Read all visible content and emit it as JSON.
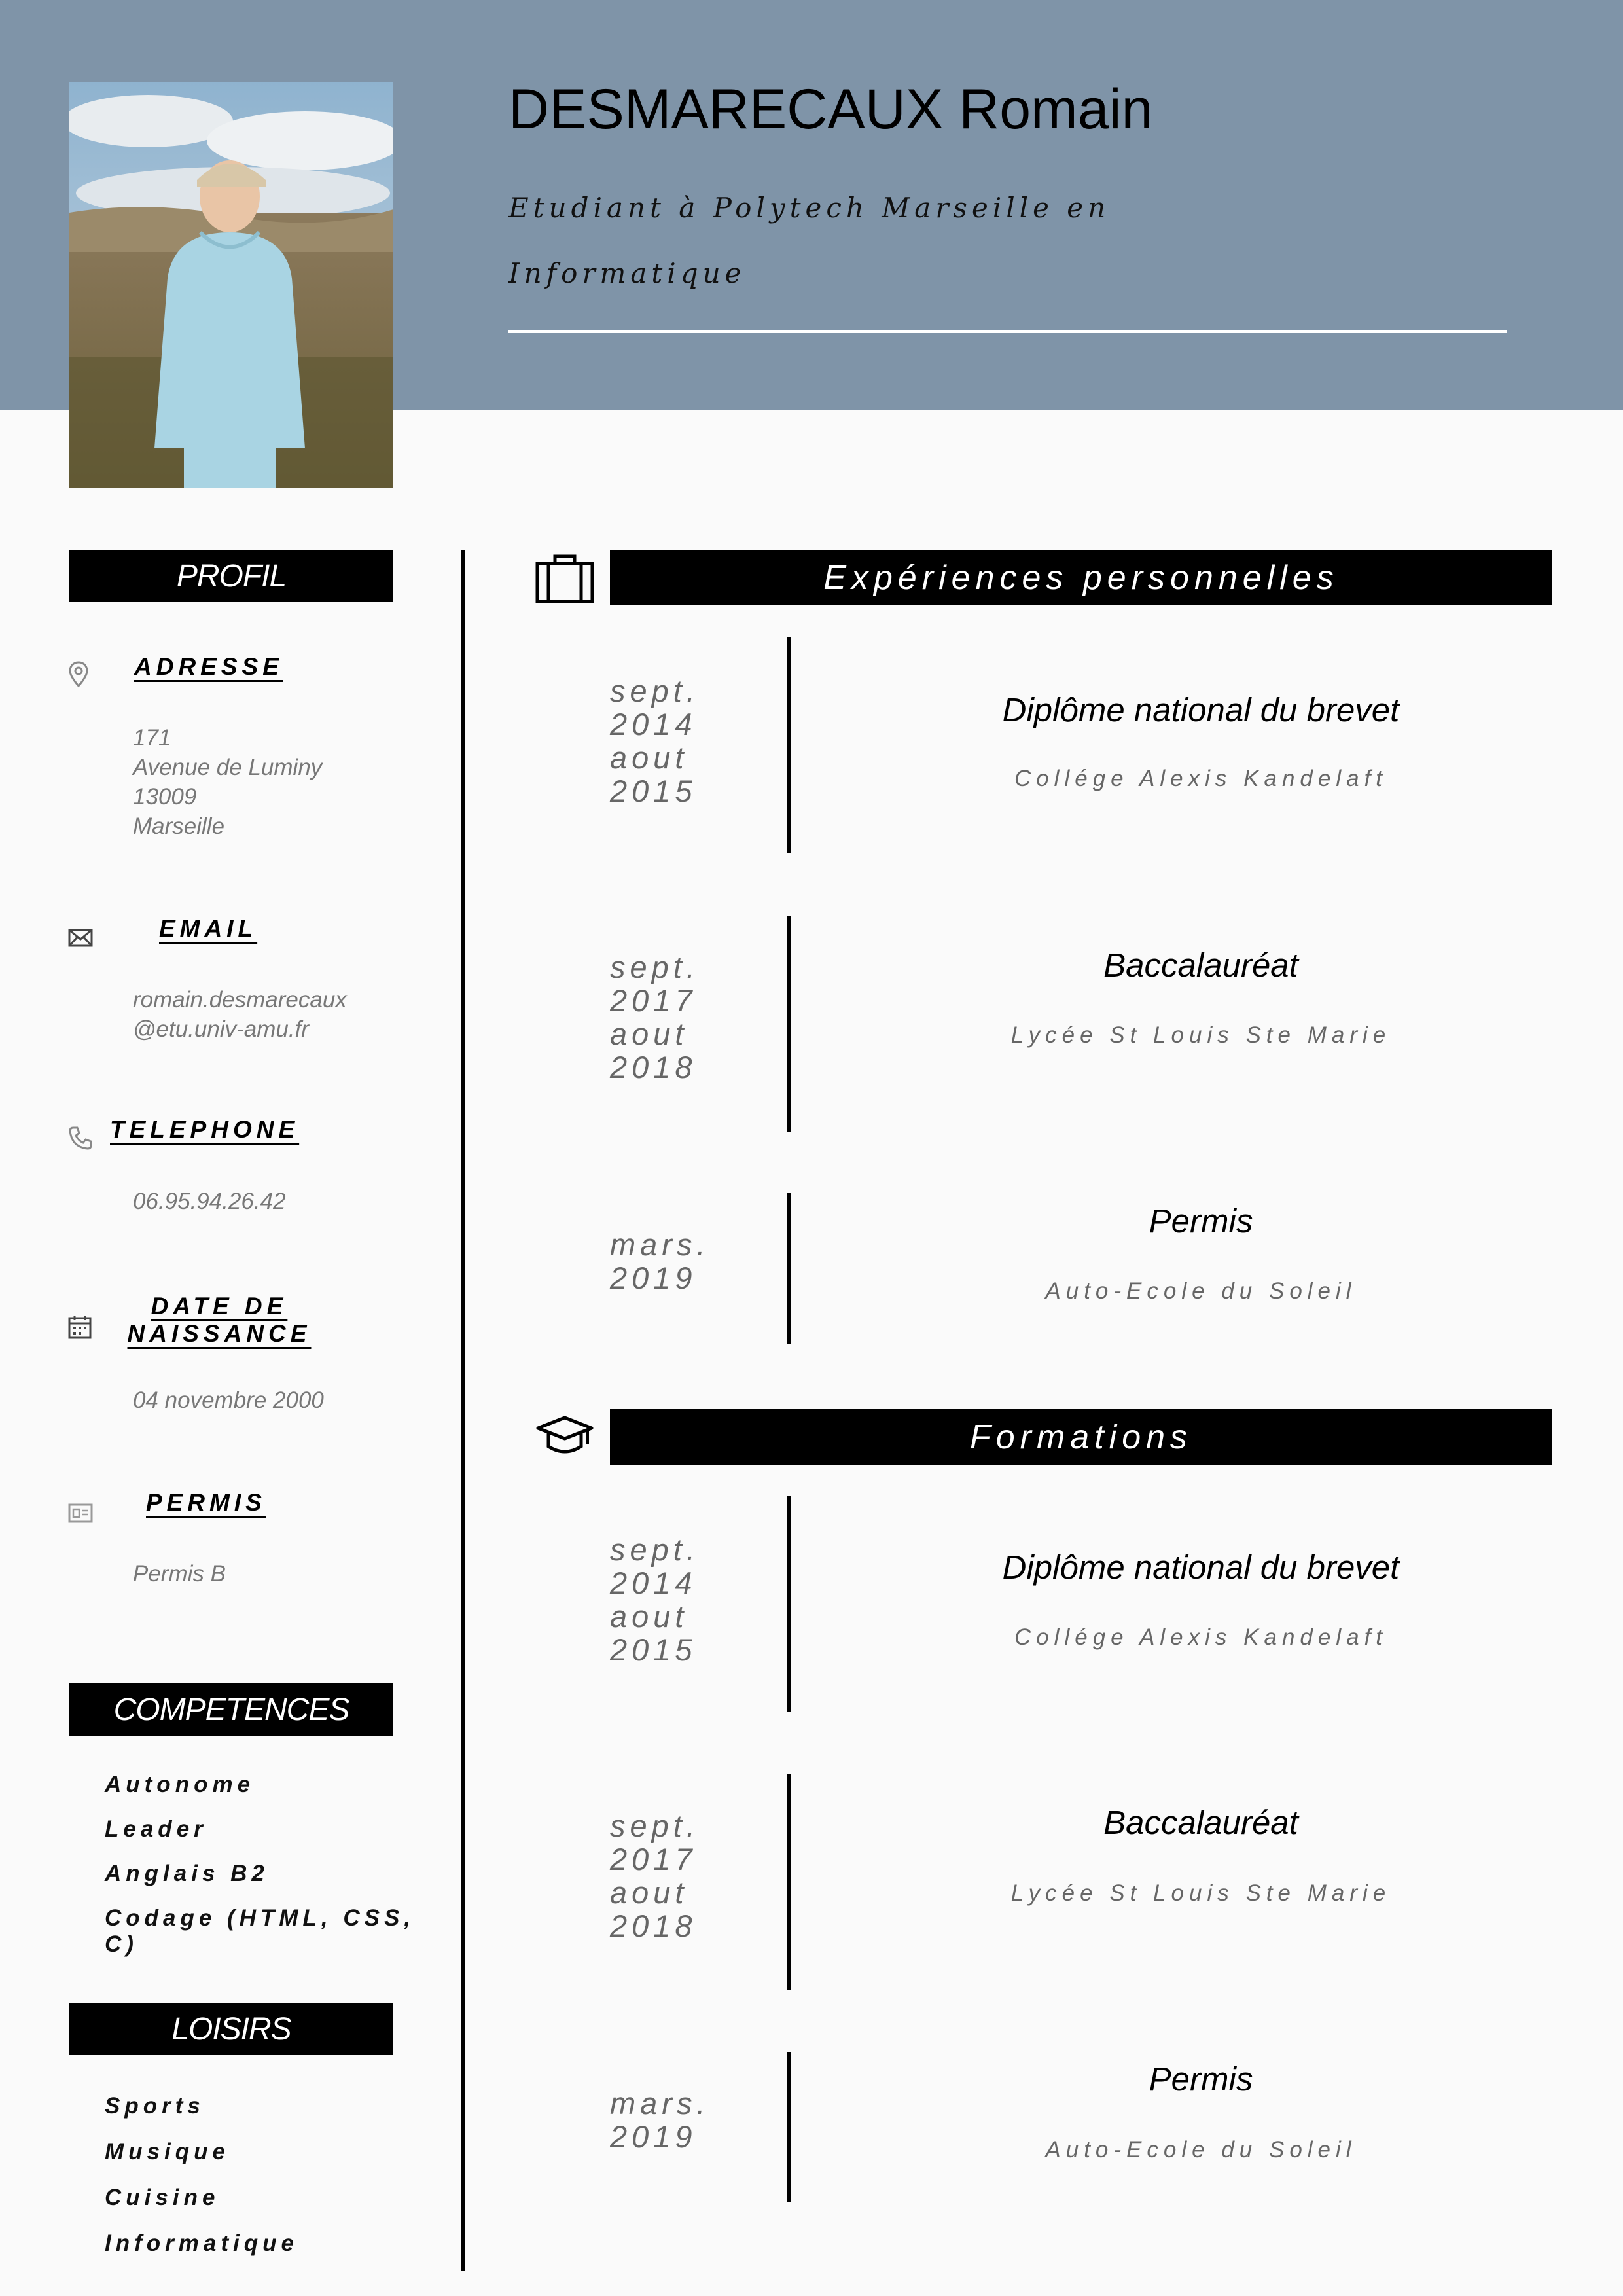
{
  "header": {
    "name": "DESMARECAUX Romain",
    "subtitle": "Etudiant à Polytech Marseille en Informatique"
  },
  "colors": {
    "header_band": "#7f94a8",
    "bars": "#000000",
    "muted_text": "#777777"
  },
  "sidebar": {
    "profil_heading": "PROFIL",
    "contact": [
      {
        "icon": "location-pin-icon",
        "title": "ADRESSE",
        "value": "171\nAvenue de Luminy\n13009\nMarseille"
      },
      {
        "icon": "envelope-icon",
        "title": "EMAIL",
        "value": "romain.desmarecaux\n@etu.univ-amu.fr"
      },
      {
        "icon": "phone-icon",
        "title": "TELEPHONE",
        "value": "06.95.94.26.42"
      },
      {
        "icon": "calendar-icon",
        "title": "DATE DE\nNAISSANCE",
        "value": "04 novembre 2000"
      },
      {
        "icon": "id-card-icon",
        "title": "PERMIS",
        "value": "Permis B"
      }
    ],
    "competences_heading": "COMPETENCES",
    "competences": [
      "Autonome",
      "Leader",
      "Anglais B2",
      "Codage (HTML, CSS, C)"
    ],
    "loisirs_heading": "LOISIRS",
    "loisirs": [
      "Sports",
      "Musique",
      "Cuisine",
      "Informatique"
    ]
  },
  "experiences": {
    "icon": "briefcase-icon",
    "heading": "Expériences personnelles",
    "entries": [
      {
        "date": "sept.\n2014\naout\n2015",
        "title": "Diplôme national du brevet",
        "subtitle": "Collége Alexis Kandelaft"
      },
      {
        "date": "sept.\n2017\naout\n2018",
        "title": "Baccalauréat",
        "subtitle": "Lycée St Louis Ste Marie"
      },
      {
        "date": "mars.\n2019",
        "title": "Permis",
        "subtitle": "Auto-Ecole du Soleil"
      }
    ]
  },
  "formations": {
    "icon": "graduation-cap-icon",
    "heading": "Formations",
    "entries": [
      {
        "date": "sept.\n2014\naout\n2015",
        "title": "Diplôme national du brevet",
        "subtitle": "Collége Alexis Kandelaft"
      },
      {
        "date": "sept.\n2017\naout\n2018",
        "title": "Baccalauréat",
        "subtitle": "Lycée St Louis Ste Marie"
      },
      {
        "date": "mars.\n2019",
        "title": "Permis",
        "subtitle": "Auto-Ecole du Soleil"
      }
    ]
  }
}
